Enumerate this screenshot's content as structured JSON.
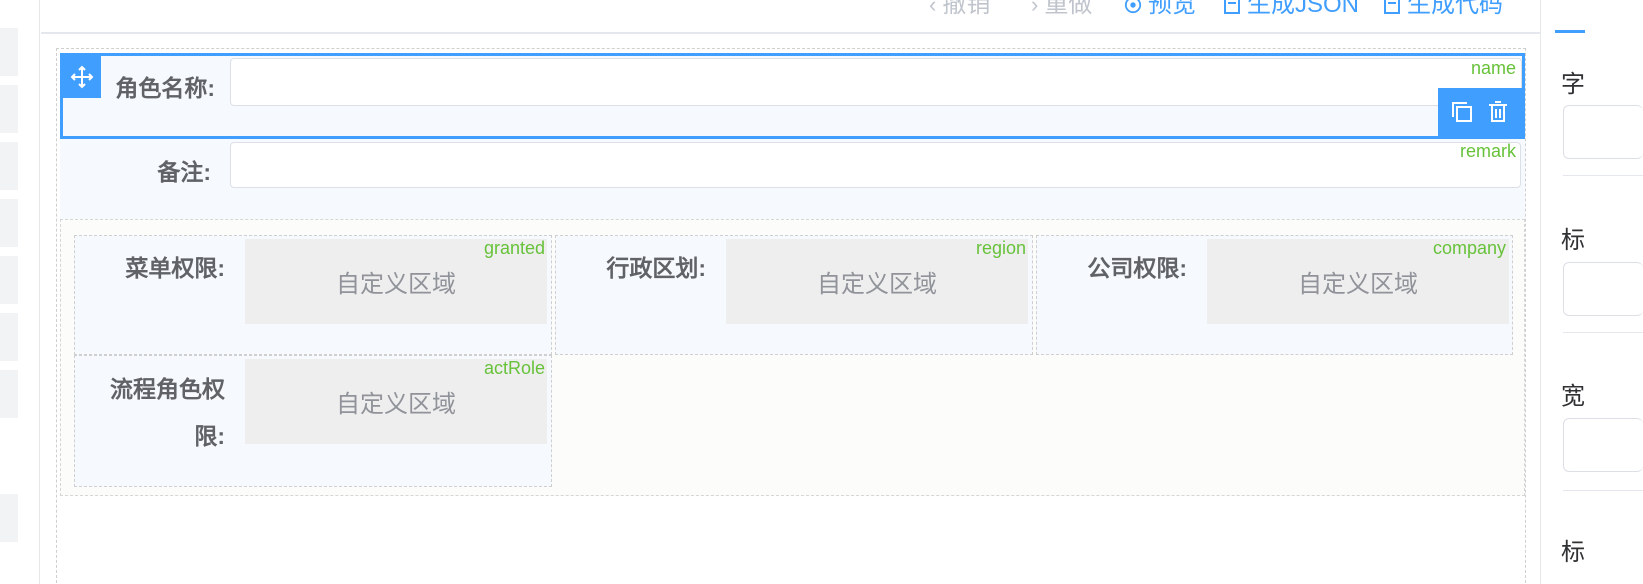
{
  "toolbar": {
    "undo": "撤销",
    "redo": "重做",
    "preview": "预览",
    "gen_json": "生成JSON",
    "gen_code": "生成代码"
  },
  "fields": {
    "name": {
      "label": "角色名称:",
      "tag": "name"
    },
    "remark": {
      "label": "备注:",
      "tag": "remark"
    },
    "granted": {
      "label": "菜单权限:",
      "tag": "granted",
      "area": "自定义区域"
    },
    "region": {
      "label": "行政区划:",
      "tag": "region",
      "area": "自定义区域"
    },
    "company": {
      "label": "公司权限:",
      "tag": "company",
      "area": "自定义区域"
    },
    "actRole": {
      "label_line1": "流程角色权",
      "label_line2": "限:",
      "tag": "actRole",
      "area": "自定义区域"
    }
  },
  "right_panel": {
    "chars": [
      "字",
      "标",
      "宽",
      "标"
    ]
  },
  "colors": {
    "primary": "#409eff",
    "tag_green": "#67c23a",
    "label_gray": "#606266",
    "disabled": "#c0c4cc"
  },
  "icons": [
    "undo-icon",
    "redo-icon",
    "eye-icon",
    "document-icon",
    "move-icon",
    "copy-icon",
    "delete-icon"
  ]
}
